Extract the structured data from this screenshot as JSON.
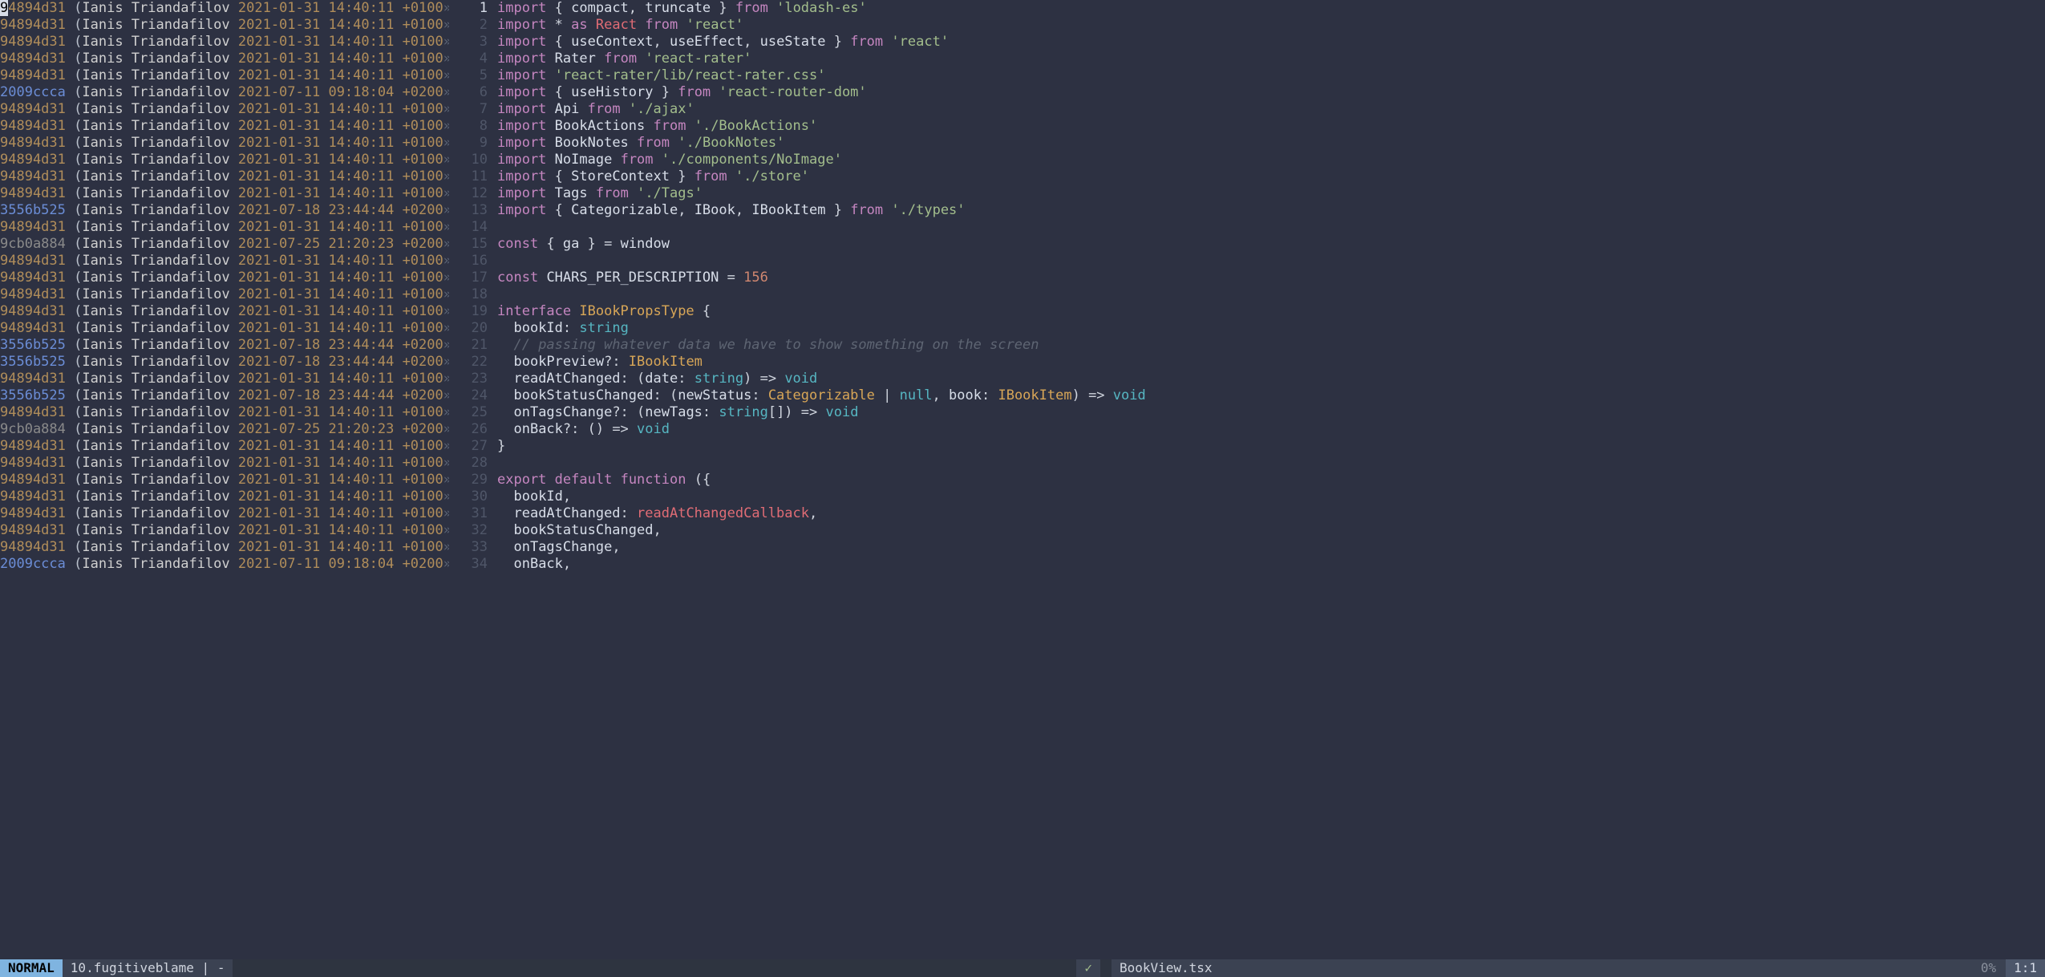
{
  "blame": {
    "hashes": {
      "a": "94894d31",
      "b": "2009ccca",
      "c": "9cb0a884",
      "d": "3556b525"
    },
    "author": "Ianis Triandafilov",
    "dates": {
      "a": "2021-01-31 14:40:11 +0100",
      "b": "2021-07-11 09:18:04 +0200",
      "c": "2021-07-25 21:20:23 +0200",
      "d": "2021-07-18 23:44:44 +0200"
    }
  },
  "lines": [
    {
      "n": 1,
      "h": "a",
      "d": "a",
      "code": [
        [
          "kw",
          "import"
        ],
        [
          "punct",
          " { "
        ],
        [
          "ident",
          "compact"
        ],
        [
          "punct",
          ", "
        ],
        [
          "ident",
          "truncate"
        ],
        [
          "punct",
          " } "
        ],
        [
          "kw",
          "from"
        ],
        [
          "punct",
          " "
        ],
        [
          "str",
          "'lodash-es'"
        ]
      ]
    },
    {
      "n": 2,
      "h": "a",
      "d": "a",
      "code": [
        [
          "kw",
          "import"
        ],
        [
          "punct",
          " * "
        ],
        [
          "kw",
          "as"
        ],
        [
          "punct",
          " "
        ],
        [
          "react",
          "React"
        ],
        [
          "punct",
          " "
        ],
        [
          "kw",
          "from"
        ],
        [
          "punct",
          " "
        ],
        [
          "str",
          "'react'"
        ]
      ]
    },
    {
      "n": 3,
      "h": "a",
      "d": "a",
      "code": [
        [
          "kw",
          "import"
        ],
        [
          "punct",
          " { "
        ],
        [
          "ident",
          "useContext"
        ],
        [
          "punct",
          ", "
        ],
        [
          "ident",
          "useEffect"
        ],
        [
          "punct",
          ", "
        ],
        [
          "ident",
          "useState"
        ],
        [
          "punct",
          " } "
        ],
        [
          "kw",
          "from"
        ],
        [
          "punct",
          " "
        ],
        [
          "str",
          "'react'"
        ]
      ]
    },
    {
      "n": 4,
      "h": "a",
      "d": "a",
      "code": [
        [
          "kw",
          "import"
        ],
        [
          "punct",
          " "
        ],
        [
          "ident",
          "Rater"
        ],
        [
          "punct",
          " "
        ],
        [
          "kw",
          "from"
        ],
        [
          "punct",
          " "
        ],
        [
          "str",
          "'react-rater'"
        ]
      ]
    },
    {
      "n": 5,
      "h": "a",
      "d": "a",
      "code": [
        [
          "kw",
          "import"
        ],
        [
          "punct",
          " "
        ],
        [
          "str",
          "'react-rater/lib/react-rater.css'"
        ]
      ]
    },
    {
      "n": 6,
      "h": "b",
      "d": "b",
      "code": [
        [
          "kw",
          "import"
        ],
        [
          "punct",
          " { "
        ],
        [
          "ident",
          "useHistory"
        ],
        [
          "punct",
          " } "
        ],
        [
          "kw",
          "from"
        ],
        [
          "punct",
          " "
        ],
        [
          "str",
          "'react-router-dom'"
        ]
      ]
    },
    {
      "n": 7,
      "h": "a",
      "d": "a",
      "code": [
        [
          "kw",
          "import"
        ],
        [
          "punct",
          " "
        ],
        [
          "ident",
          "Api"
        ],
        [
          "punct",
          " "
        ],
        [
          "kw",
          "from"
        ],
        [
          "punct",
          " "
        ],
        [
          "str",
          "'./ajax'"
        ]
      ]
    },
    {
      "n": 8,
      "h": "a",
      "d": "a",
      "code": [
        [
          "kw",
          "import"
        ],
        [
          "punct",
          " "
        ],
        [
          "ident",
          "BookActions"
        ],
        [
          "punct",
          " "
        ],
        [
          "kw",
          "from"
        ],
        [
          "punct",
          " "
        ],
        [
          "str",
          "'./BookActions'"
        ]
      ]
    },
    {
      "n": 9,
      "h": "a",
      "d": "a",
      "code": [
        [
          "kw",
          "import"
        ],
        [
          "punct",
          " "
        ],
        [
          "ident",
          "BookNotes"
        ],
        [
          "punct",
          " "
        ],
        [
          "kw",
          "from"
        ],
        [
          "punct",
          " "
        ],
        [
          "str",
          "'./BookNotes'"
        ]
      ]
    },
    {
      "n": 10,
      "h": "a",
      "d": "a",
      "code": [
        [
          "kw",
          "import"
        ],
        [
          "punct",
          " "
        ],
        [
          "ident",
          "NoImage"
        ],
        [
          "punct",
          " "
        ],
        [
          "kw",
          "from"
        ],
        [
          "punct",
          " "
        ],
        [
          "str",
          "'./components/NoImage'"
        ]
      ]
    },
    {
      "n": 11,
      "h": "a",
      "d": "a",
      "code": [
        [
          "kw",
          "import"
        ],
        [
          "punct",
          " { "
        ],
        [
          "ident",
          "StoreContext"
        ],
        [
          "punct",
          " } "
        ],
        [
          "kw",
          "from"
        ],
        [
          "punct",
          " "
        ],
        [
          "str",
          "'./store'"
        ]
      ]
    },
    {
      "n": 12,
      "h": "a",
      "d": "a",
      "code": [
        [
          "kw",
          "import"
        ],
        [
          "punct",
          " "
        ],
        [
          "ident",
          "Tags"
        ],
        [
          "punct",
          " "
        ],
        [
          "kw",
          "from"
        ],
        [
          "punct",
          " "
        ],
        [
          "str",
          "'./Tags'"
        ]
      ]
    },
    {
      "n": 13,
      "h": "d",
      "d": "d",
      "code": [
        [
          "kw",
          "import"
        ],
        [
          "punct",
          " { "
        ],
        [
          "ident",
          "Categorizable"
        ],
        [
          "punct",
          ", "
        ],
        [
          "ident",
          "IBook"
        ],
        [
          "punct",
          ", "
        ],
        [
          "ident",
          "IBookItem"
        ],
        [
          "punct",
          " } "
        ],
        [
          "kw",
          "from"
        ],
        [
          "punct",
          " "
        ],
        [
          "str",
          "'./types'"
        ]
      ]
    },
    {
      "n": 14,
      "h": "a",
      "d": "a",
      "code": []
    },
    {
      "n": 15,
      "h": "c",
      "d": "c",
      "code": [
        [
          "kw",
          "const"
        ],
        [
          "punct",
          " { "
        ],
        [
          "ident",
          "ga"
        ],
        [
          "punct",
          " } = "
        ],
        [
          "ident",
          "window"
        ]
      ]
    },
    {
      "n": 16,
      "h": "a",
      "d": "a",
      "code": []
    },
    {
      "n": 17,
      "h": "a",
      "d": "a",
      "code": [
        [
          "kw",
          "const"
        ],
        [
          "punct",
          " "
        ],
        [
          "ident",
          "CHARS_PER_DESCRIPTION"
        ],
        [
          "punct",
          " = "
        ],
        [
          "num",
          "156"
        ]
      ]
    },
    {
      "n": 18,
      "h": "a",
      "d": "a",
      "code": []
    },
    {
      "n": 19,
      "h": "a",
      "d": "a",
      "code": [
        [
          "kw",
          "interface"
        ],
        [
          "punct",
          " "
        ],
        [
          "typename",
          "IBookPropsType"
        ],
        [
          "punct",
          " {"
        ]
      ]
    },
    {
      "n": 20,
      "h": "a",
      "d": "a",
      "code": [
        [
          "punct",
          "  "
        ],
        [
          "ident",
          "bookId"
        ],
        [
          "punct",
          ": "
        ],
        [
          "builtin",
          "string"
        ]
      ]
    },
    {
      "n": 21,
      "h": "d",
      "d": "d",
      "code": [
        [
          "punct",
          "  "
        ],
        [
          "comment",
          "// passing whatever data we have to show something on the screen"
        ]
      ]
    },
    {
      "n": 22,
      "h": "d",
      "d": "d",
      "code": [
        [
          "punct",
          "  "
        ],
        [
          "ident",
          "bookPreview"
        ],
        [
          "punct",
          "?: "
        ],
        [
          "typename",
          "IBookItem"
        ]
      ]
    },
    {
      "n": 23,
      "h": "a",
      "d": "a",
      "code": [
        [
          "punct",
          "  "
        ],
        [
          "ident",
          "readAtChanged"
        ],
        [
          "punct",
          ": ("
        ],
        [
          "ident",
          "date"
        ],
        [
          "punct",
          ": "
        ],
        [
          "builtin",
          "string"
        ],
        [
          "punct",
          ") => "
        ],
        [
          "builtin",
          "void"
        ]
      ]
    },
    {
      "n": 24,
      "h": "d",
      "d": "d",
      "code": [
        [
          "punct",
          "  "
        ],
        [
          "ident",
          "bookStatusChanged"
        ],
        [
          "punct",
          ": ("
        ],
        [
          "ident",
          "newStatus"
        ],
        [
          "punct",
          ": "
        ],
        [
          "typename",
          "Categorizable"
        ],
        [
          "punct",
          " | "
        ],
        [
          "builtin",
          "null"
        ],
        [
          "punct",
          ", "
        ],
        [
          "ident",
          "book"
        ],
        [
          "punct",
          ": "
        ],
        [
          "typename",
          "IBookItem"
        ],
        [
          "punct",
          ") => "
        ],
        [
          "builtin",
          "void"
        ]
      ]
    },
    {
      "n": 25,
      "h": "a",
      "d": "a",
      "code": [
        [
          "punct",
          "  "
        ],
        [
          "ident",
          "onTagsChange"
        ],
        [
          "punct",
          "?: ("
        ],
        [
          "ident",
          "newTags"
        ],
        [
          "punct",
          ": "
        ],
        [
          "builtin",
          "string"
        ],
        [
          "punct",
          "[]) => "
        ],
        [
          "builtin",
          "void"
        ]
      ]
    },
    {
      "n": 26,
      "h": "c",
      "d": "c",
      "code": [
        [
          "punct",
          "  "
        ],
        [
          "ident",
          "onBack"
        ],
        [
          "punct",
          "?: () => "
        ],
        [
          "builtin",
          "void"
        ]
      ]
    },
    {
      "n": 27,
      "h": "a",
      "d": "a",
      "code": [
        [
          "punct",
          "}"
        ]
      ]
    },
    {
      "n": 28,
      "h": "a",
      "d": "a",
      "code": []
    },
    {
      "n": 29,
      "h": "a",
      "d": "a",
      "code": [
        [
          "kw",
          "export"
        ],
        [
          "punct",
          " "
        ],
        [
          "kw",
          "default"
        ],
        [
          "punct",
          " "
        ],
        [
          "kw",
          "function"
        ],
        [
          "punct",
          " ({"
        ]
      ]
    },
    {
      "n": 30,
      "h": "a",
      "d": "a",
      "code": [
        [
          "punct",
          "  "
        ],
        [
          "ident",
          "bookId"
        ],
        [
          "punct",
          ","
        ]
      ]
    },
    {
      "n": 31,
      "h": "a",
      "d": "a",
      "code": [
        [
          "punct",
          "  "
        ],
        [
          "ident",
          "readAtChanged"
        ],
        [
          "punct",
          ": "
        ],
        [
          "react",
          "readAtChangedCallback"
        ],
        [
          "punct",
          ","
        ]
      ]
    },
    {
      "n": 32,
      "h": "a",
      "d": "a",
      "code": [
        [
          "punct",
          "  "
        ],
        [
          "ident",
          "bookStatusChanged"
        ],
        [
          "punct",
          ","
        ]
      ]
    },
    {
      "n": 33,
      "h": "a",
      "d": "a",
      "code": [
        [
          "punct",
          "  "
        ],
        [
          "ident",
          "onTagsChange"
        ],
        [
          "punct",
          ","
        ]
      ]
    },
    {
      "n": 34,
      "h": "b",
      "d": "b",
      "code": [
        [
          "punct",
          "  "
        ],
        [
          "ident",
          "onBack"
        ],
        [
          "punct",
          ","
        ]
      ]
    }
  ],
  "status": {
    "mode": "NORMAL",
    "left_file": "10.fugitiveblame",
    "left_sep": " | -",
    "check": "✓",
    "right_file": "BookView.tsx",
    "pct": "0%",
    "pos": "1:1"
  }
}
